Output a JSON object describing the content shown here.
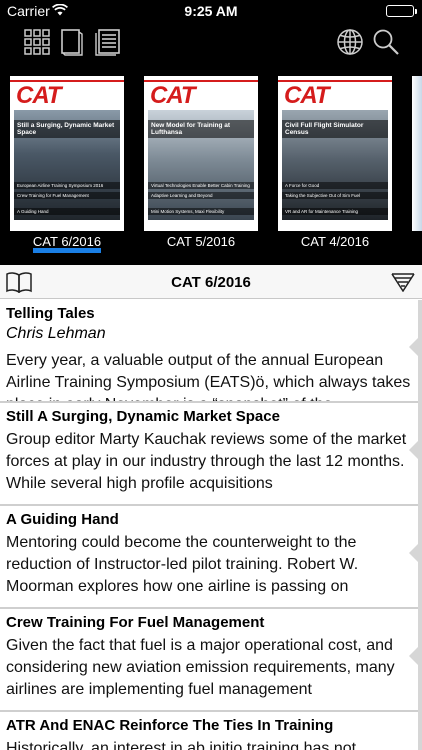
{
  "status_bar": {
    "carrier": "Carrier",
    "time": "9:25 AM"
  },
  "toolbar": {
    "left_icons": [
      "grid-icon",
      "single-page-icon",
      "list-pages-icon"
    ],
    "right_icons": [
      "globe-icon",
      "search-icon"
    ]
  },
  "covers": [
    {
      "label": "CAT 6/2016",
      "logo": "CAT",
      "headline": "Still a Surging, Dynamic Market Space",
      "sub1": "European Airline Training Symposium 2016",
      "sub2": "Crew Training for Fuel Management",
      "sub3": "A Guiding Hand",
      "active": true
    },
    {
      "label": "CAT 5/2016",
      "logo": "CAT",
      "headline": "New Model for Training at Lufthansa",
      "sub1": "Virtual Technologies Enable Better Cabin Training",
      "sub2": "Adaptive Learning and Beyond",
      "sub3": "Mini Motion Systems, Maxi Flexibility",
      "active": false
    },
    {
      "label": "CAT 4/2016",
      "logo": "CAT",
      "headline": "Civil Full Flight Simulator Census",
      "sub1": "A Force for Good",
      "sub2": "Taking the Subjective Out of Sim Fuel",
      "sub3": "VR and AR for Maintenance Training",
      "active": false
    }
  ],
  "issue_header": {
    "title": "CAT 6/2016"
  },
  "articles": [
    {
      "title": "Telling Tales",
      "author": "Chris Lehman",
      "body": "Every year, a valuable output of the annual European Airline Training Symposium (EATS)ö, which always takes place in early November is a “snapshot” of the"
    },
    {
      "title": "Still A Surging, Dynamic Market Space",
      "author": "",
      "body": "Group editor Marty Kauchak reviews some of the market forces at play in our industry through the last 12 months.  While several high profile acquisitions"
    },
    {
      "title": "A Guiding Hand",
      "author": "",
      "body": "Mentoring could become the counterweight to the reduction of Instructor-led pilot training. Robert W. Moorman explores how one airline is passing on"
    },
    {
      "title": "Crew Training For Fuel Management",
      "author": "",
      "body": "Given the fact that fuel is a major operational cost, and considering new aviation emission requirements, many airlines are implementing fuel management"
    },
    {
      "title": "ATR And ENAC Reinforce The Ties In Training",
      "author": "",
      "body": "Historically, an interest in ab initio training has not"
    }
  ]
}
